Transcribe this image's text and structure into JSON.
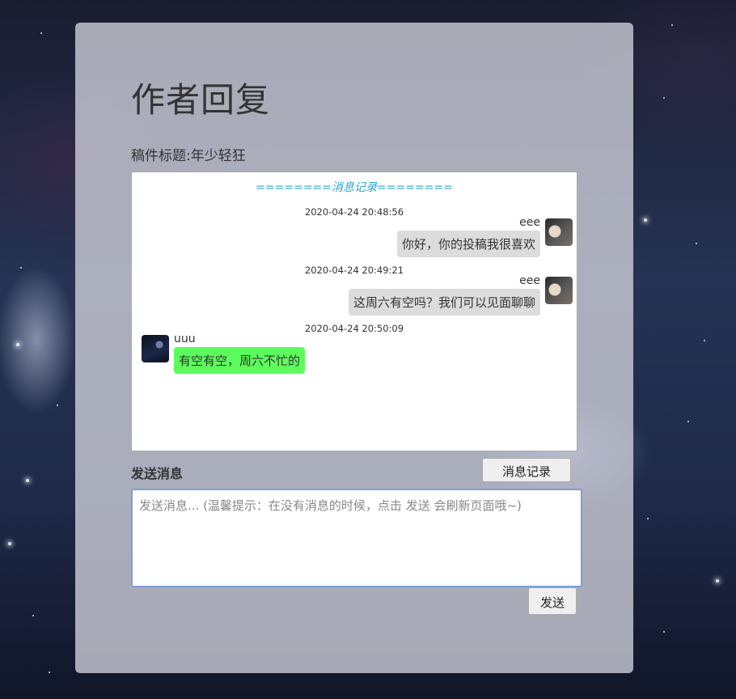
{
  "page": {
    "title": "作者回复",
    "subject": "稿件标题:年少轻狂"
  },
  "history": {
    "header": "========消息记录========",
    "messages": [
      {
        "time": "2020-04-24 20:48:56",
        "sender": "eee",
        "text": "你好，你的投稿我很喜欢",
        "side": "right",
        "bubble_color": "#dcdcdc"
      },
      {
        "time": "2020-04-24 20:49:21",
        "sender": "eee",
        "text": "这周六有空吗？我们可以见面聊聊",
        "side": "right",
        "bubble_color": "#dcdcdc"
      },
      {
        "time": "2020-04-24 20:50:09",
        "sender": "uuu",
        "text": "有空有空，周六不忙的",
        "side": "left",
        "bubble_color": "#5cfc5c"
      }
    ]
  },
  "compose": {
    "label": "发送消息",
    "history_button": "消息记录",
    "placeholder": "发送消息... (温馨提示：在没有消息的时候，点击 发送 会刷新页面哦~)",
    "value": "",
    "send_button": "发送"
  },
  "colors": {
    "header_accent": "#2ba6cb",
    "input_border": "#7a9fd6"
  }
}
